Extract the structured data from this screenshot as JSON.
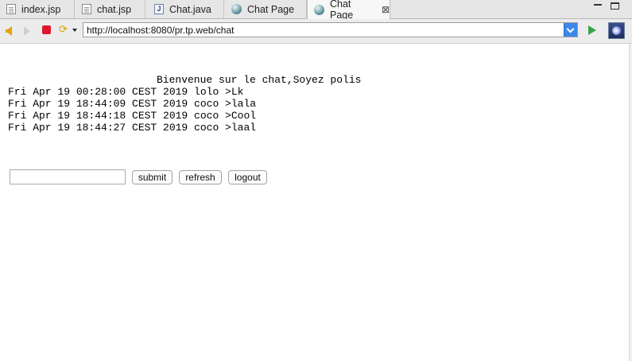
{
  "tabs": [
    {
      "label": "index.jsp",
      "icon": "jsp-file-icon"
    },
    {
      "label": "chat.jsp",
      "icon": "jsp-file-icon"
    },
    {
      "label": "Chat.java",
      "icon": "java-file-icon"
    },
    {
      "label": "Chat Page",
      "icon": "globe-icon"
    },
    {
      "label": "Chat Page",
      "icon": "globe-icon",
      "active": true,
      "closable": true
    }
  ],
  "tab_close_glyph": "⊠",
  "java_icon_letter": "J",
  "toolbar": {
    "url": "http://localhost:8080/pr.tp.web/chat",
    "refresh_glyph": "⟳"
  },
  "page": {
    "welcome": "Bienvenue sur le chat,Soyez polis",
    "messages": [
      "Fri Apr 19 00:28:00 CEST 2019 lolo >Lk",
      "Fri Apr 19 18:44:09 CEST 2019 coco >lala",
      "Fri Apr 19 18:44:18 CEST 2019 coco >Cool",
      "Fri Apr 19 18:44:27 CEST 2019 coco >laal"
    ],
    "input_value": "",
    "buttons": {
      "submit": "submit",
      "refresh": "refresh",
      "logout": "logout"
    }
  },
  "colors": {
    "stop": "#e0152e",
    "go": "#3aa44a",
    "back": "#e2a300"
  }
}
